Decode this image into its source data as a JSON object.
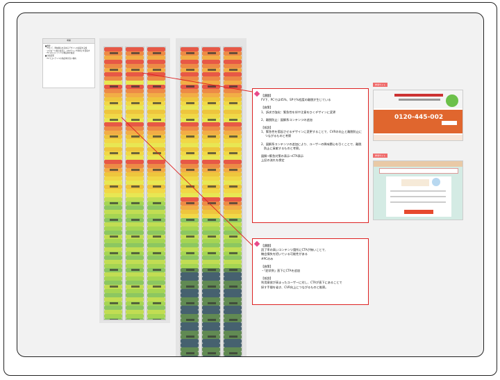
{
  "notes_card": {
    "title": "考察",
    "lines": [
      "■概要",
      "・FVにて、興味関心を高めるデザインの検証を実施",
      "・スクロール率の改善と、CTAクリック率向上を目指す",
      "・FV下のコンテンツの熟読率を確認",
      "■分析結果",
      "・FV下コンテンツの熟読率が高い傾向"
    ]
  },
  "board": {
    "colors": {
      "accent_red": "#dd2222",
      "bullet_pink": "#e84a8a",
      "tag": "#ef6c6c",
      "heat_hot": "#e8402a",
      "heat_warm": "#f0c020",
      "heat_cool": "#9ad23a"
    }
  },
  "callout_1": {
    "title": "【課題】",
    "lines_a": [
      "FV下、PCでは45%、SPで%程度の離脱が生じている"
    ],
    "measure_title": "【施策】",
    "measures": [
      "1、訴求力強化：緊急性を伴や注意をひくデザインに変更",
      "2、離脱防止：図解系コンテンツの追加"
    ],
    "hypo_title": "【仮説】",
    "hypos": [
      "1、緊急性を惹起させるデザインに変更することで、CVRの向上と離脱防止に",
      "　 つながるものと考察",
      "2、図解系コンテンツの追加により、ユーザーの興味関心を引くことで、離脱",
      "   防止に貢献するものと考察。",
      "",
      "図解→緊急対策の表示→CTA表示",
      "上記の流れを想定"
    ]
  },
  "callout_2": {
    "title": "【課題】",
    "lines_a": [
      "読了率の高いコンテンツ箇所にCTAが無いことで、",
      "機会損失を招いている可能性がある",
      "#PCのみ"
    ],
    "measure_title": "【施策】",
    "measures": [
      "・「症状例」直下にCTAを追加"
    ],
    "hypo_title": "【仮説】",
    "hypos": [
      "利用意欲が高まったユーザーに対し、CTAが直下にあることで",
      "探す手間を省き、CVR向上につながるものと推察。"
    ]
  },
  "reference_1": {
    "tag": "参考サイト",
    "phone": "0120-445-002"
  },
  "reference_2": {
    "tag": "参考サイト"
  }
}
